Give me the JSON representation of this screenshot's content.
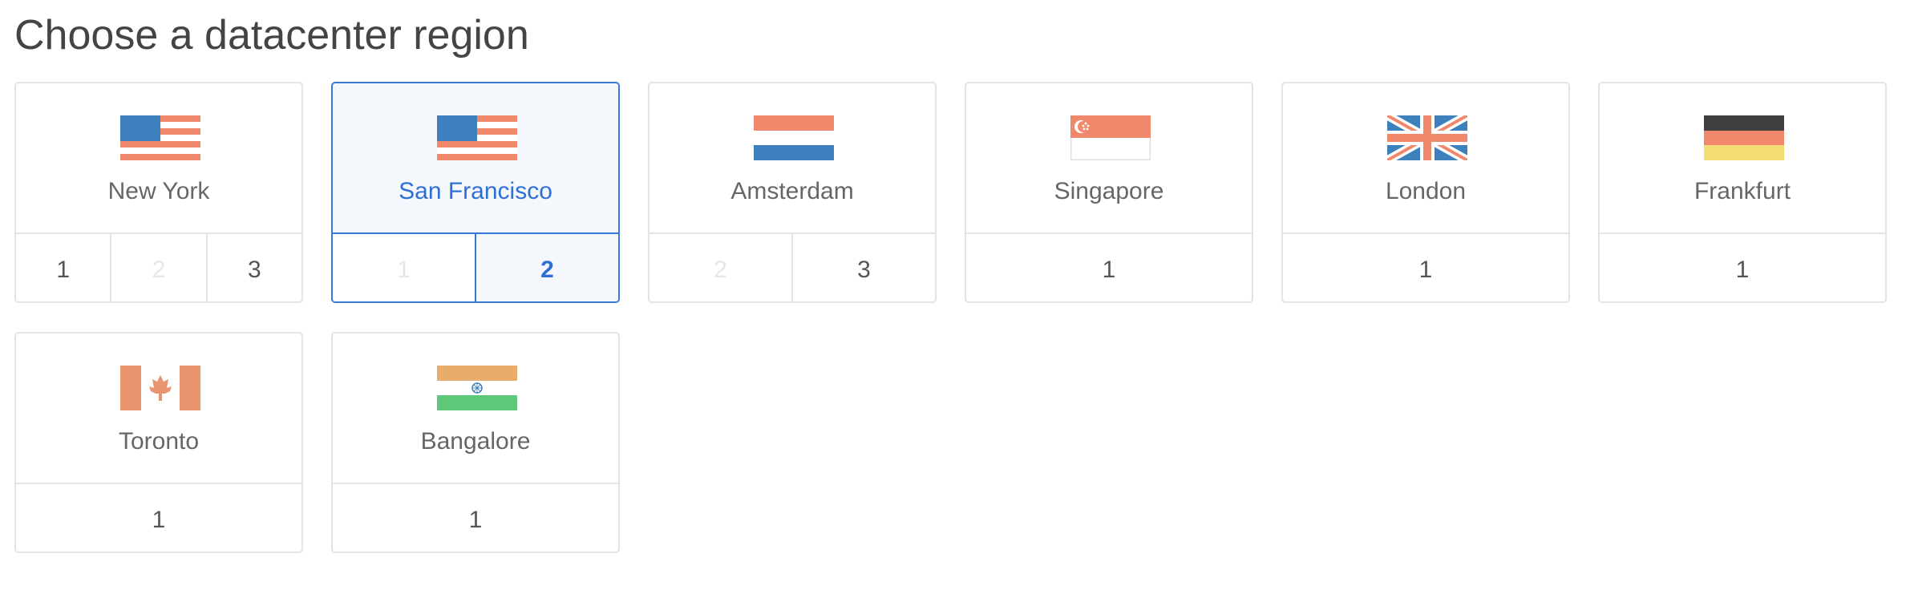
{
  "title": "Choose a datacenter region",
  "regions": [
    {
      "name": "New York",
      "flag": "flag-us-icon",
      "versions": [
        "1",
        "2",
        "3"
      ]
    },
    {
      "name": "San Francisco",
      "flag": "flag-us-icon",
      "versions": [
        "1",
        "2"
      ]
    },
    {
      "name": "Amsterdam",
      "flag": "flag-nl-icon",
      "versions": [
        "2",
        "3"
      ]
    },
    {
      "name": "Singapore",
      "flag": "flag-sg-icon",
      "versions": [
        "1"
      ]
    },
    {
      "name": "London",
      "flag": "flag-uk-icon",
      "versions": [
        "1"
      ]
    },
    {
      "name": "Frankfurt",
      "flag": "flag-de-icon",
      "versions": [
        "1"
      ]
    },
    {
      "name": "Toronto",
      "flag": "flag-ca-icon",
      "versions": [
        "1"
      ]
    },
    {
      "name": "Bangalore",
      "flag": "flag-in-icon",
      "versions": [
        "1"
      ]
    }
  ],
  "selected_region": "San Francisco",
  "selected_version": "2",
  "disabled_versions": {
    "New York": [
      "2"
    ],
    "San Francisco": [
      "1"
    ],
    "Amsterdam": [
      "2"
    ]
  },
  "colors": {
    "accent": "#2e6fd6",
    "flag_blue": "#3e80bd",
    "flag_red": "#f0896b",
    "flag_black": "#3f3f3f",
    "flag_yellow": "#f6dc74",
    "flag_saffron": "#e8ac6c",
    "flag_green": "#5cc878",
    "flag_canada": "#e8956f"
  }
}
